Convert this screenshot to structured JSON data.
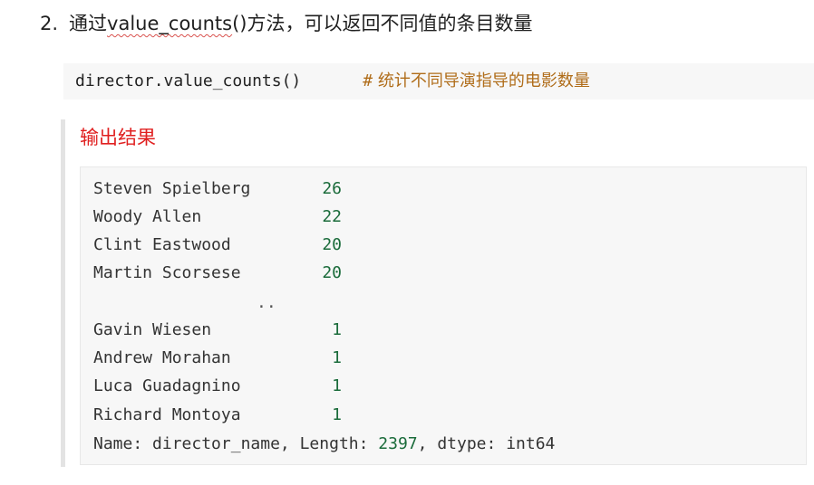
{
  "heading": {
    "number": "2.",
    "prefix": "通过",
    "code_word": "value_counts",
    "suffix": "()方法，可以返回不同值的条目数量"
  },
  "code": {
    "statement": "director.value_counts()",
    "comment_hash": "#",
    "comment_text": " 统计不同导演指导的电影数量"
  },
  "output": {
    "title": "输出结果",
    "rows_top": [
      {
        "name": "Steven Spielberg",
        "count": "26"
      },
      {
        "name": "Woody Allen",
        "count": "22"
      },
      {
        "name": "Clint Eastwood",
        "count": "20"
      },
      {
        "name": "Martin Scorsese",
        "count": "20"
      }
    ],
    "ellipsis": "..",
    "rows_bottom": [
      {
        "name": "Gavin Wiesen",
        "count": "1"
      },
      {
        "name": "Andrew Morahan",
        "count": "1"
      },
      {
        "name": "Luca Guadagnino",
        "count": "1"
      },
      {
        "name": "Richard Montoya",
        "count": "1"
      }
    ],
    "summary": {
      "name_label": "Name: ",
      "name_value": "director_name",
      "length_label": ", Length: ",
      "length_value": "2397",
      "dtype_label": ", dtype: ",
      "dtype_value": "int64"
    }
  }
}
